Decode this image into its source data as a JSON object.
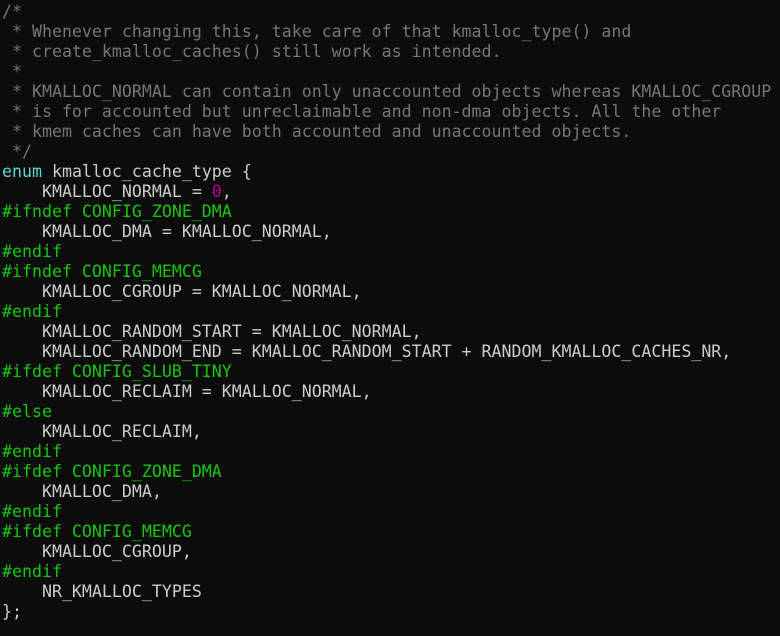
{
  "editor": {
    "lines": [
      [
        {
          "t": "/*",
          "c": "comment"
        }
      ],
      [
        {
          "t": " * Whenever changing this, take care of that kmalloc_type() and",
          "c": "comment"
        }
      ],
      [
        {
          "t": " * create_kmalloc_caches() still work as intended.",
          "c": "comment"
        }
      ],
      [
        {
          "t": " *",
          "c": "comment"
        }
      ],
      [
        {
          "t": " * KMALLOC_NORMAL can contain only unaccounted objects whereas KMALLOC_CGROUP",
          "c": "comment"
        }
      ],
      [
        {
          "t": " * is for accounted but unreclaimable and non-dma objects. All the other",
          "c": "comment"
        }
      ],
      [
        {
          "t": " * kmem caches can have both accounted and unaccounted objects.",
          "c": "comment"
        }
      ],
      [
        {
          "t": " */",
          "c": "comment"
        }
      ],
      [
        {
          "t": "enum",
          "c": "keyword"
        },
        {
          "t": " kmalloc_cache_type {",
          "c": "plain"
        }
      ],
      [
        {
          "t": "    KMALLOC_NORMAL = ",
          "c": "plain"
        },
        {
          "t": "0",
          "c": "number"
        },
        {
          "t": ",",
          "c": "plain"
        }
      ],
      [
        {
          "t": "#ifndef CONFIG_ZONE_DMA",
          "c": "preproc"
        }
      ],
      [
        {
          "t": "    KMALLOC_DMA = KMALLOC_NORMAL,",
          "c": "plain"
        }
      ],
      [
        {
          "t": "#endif",
          "c": "preproc"
        }
      ],
      [
        {
          "t": "#ifndef CONFIG_MEMCG",
          "c": "preproc"
        }
      ],
      [
        {
          "t": "    KMALLOC_CGROUP = KMALLOC_NORMAL,",
          "c": "plain"
        }
      ],
      [
        {
          "t": "#endif",
          "c": "preproc"
        }
      ],
      [
        {
          "t": "    KMALLOC_RANDOM_START = KMALLOC_NORMAL,",
          "c": "plain"
        }
      ],
      [
        {
          "t": "    KMALLOC_RANDOM_END = KMALLOC_RANDOM_START + RANDOM_KMALLOC_CACHES_NR,",
          "c": "plain"
        }
      ],
      [
        {
          "t": "#ifdef CONFIG_SLUB_TINY",
          "c": "preproc"
        }
      ],
      [
        {
          "t": "    KMALLOC_RECLAIM = KMALLOC_NORMAL,",
          "c": "plain"
        }
      ],
      [
        {
          "t": "#else",
          "c": "preproc"
        }
      ],
      [
        {
          "t": "    KMALLOC_RECLAIM,",
          "c": "plain"
        }
      ],
      [
        {
          "t": "#endif",
          "c": "preproc"
        }
      ],
      [
        {
          "t": "#ifdef CONFIG_ZONE_DMA",
          "c": "preproc"
        }
      ],
      [
        {
          "t": "    KMALLOC_DMA,",
          "c": "plain"
        }
      ],
      [
        {
          "t": "#endif",
          "c": "preproc"
        }
      ],
      [
        {
          "t": "#ifdef CONFIG_MEMCG",
          "c": "preproc"
        }
      ],
      [
        {
          "t": "    KMALLOC_CGROUP,",
          "c": "plain"
        }
      ],
      [
        {
          "t": "#endif",
          "c": "preproc"
        }
      ],
      [
        {
          "t": "    NR_KMALLOC_TYPES",
          "c": "plain"
        }
      ],
      [
        {
          "t": "};",
          "c": "plain"
        }
      ]
    ]
  },
  "colors": {
    "background": "#0c0c0c",
    "comment": "#767676",
    "keyword": "#61d6d6",
    "preproc": "#16c60c",
    "number": "#b4009e",
    "plain": "#cccccc"
  }
}
